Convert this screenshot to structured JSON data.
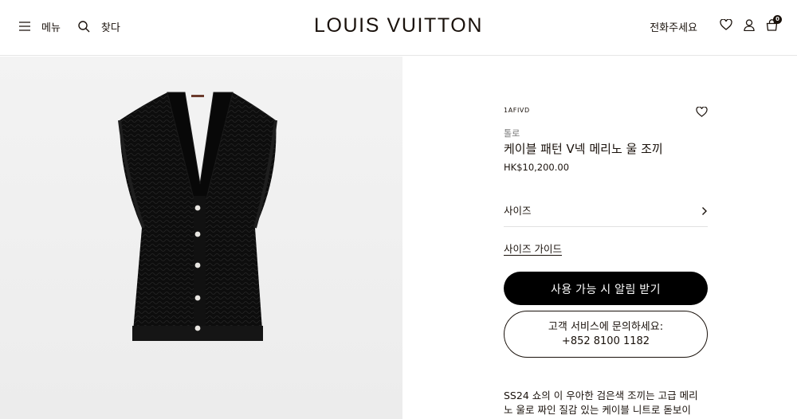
{
  "header": {
    "menu_label": "메뉴",
    "menu_icon": "hamburger-icon",
    "search_label": "찾다",
    "search_icon": "search-icon",
    "logo": "LOUIS VUITTON",
    "call_label": "전화주세요",
    "wishlist_icon": "heart-icon",
    "account_icon": "user-icon",
    "bag_icon": "shopping-bag-icon",
    "bag_count": "0"
  },
  "product": {
    "sku": "1AFIVD",
    "collection": "톨로",
    "name": "케이블 패턴 V넥 메리노 울 조끼",
    "price": "HK$10,200.00",
    "size_label": "사이즈",
    "size_guide_label": "사이즈 가이드",
    "notify_label": "사용 가능 시 알림 받기",
    "contact_line1": "고객 서비스에 문의하세요:",
    "contact_line2": "+852 8100 1182",
    "description_line1": "SS24 쇼의 이 우아한 검은색 조끼는 고급 메리",
    "description_line2": "노 울로 짜인 질감 있는 케이블 니트로 돋보이"
  },
  "colors": {
    "text": "#19110b",
    "button_bg": "#000000",
    "gallery_bg": "#efefef",
    "garment": "#0d0d0d"
  }
}
